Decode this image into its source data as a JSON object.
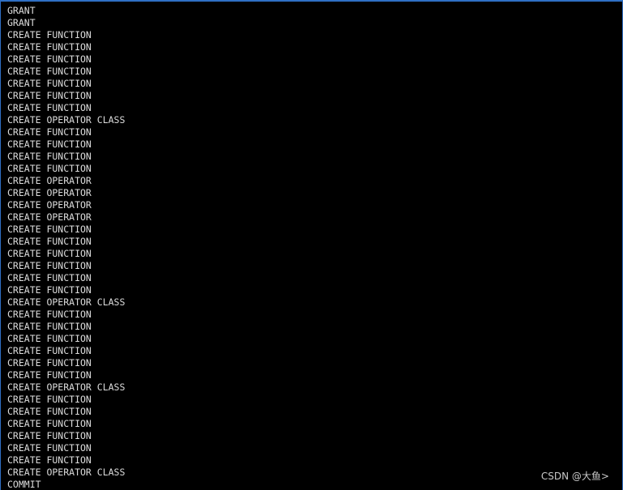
{
  "terminal": {
    "output_lines": [
      "GRANT",
      "GRANT",
      "CREATE FUNCTION",
      "CREATE FUNCTION",
      "CREATE FUNCTION",
      "CREATE FUNCTION",
      "CREATE FUNCTION",
      "CREATE FUNCTION",
      "CREATE FUNCTION",
      "CREATE OPERATOR CLASS",
      "CREATE FUNCTION",
      "CREATE FUNCTION",
      "CREATE FUNCTION",
      "CREATE FUNCTION",
      "CREATE OPERATOR",
      "CREATE OPERATOR",
      "CREATE OPERATOR",
      "CREATE OPERATOR",
      "CREATE FUNCTION",
      "CREATE FUNCTION",
      "CREATE FUNCTION",
      "CREATE FUNCTION",
      "CREATE FUNCTION",
      "CREATE FUNCTION",
      "CREATE OPERATOR CLASS",
      "CREATE FUNCTION",
      "CREATE FUNCTION",
      "CREATE FUNCTION",
      "CREATE FUNCTION",
      "CREATE FUNCTION",
      "CREATE FUNCTION",
      "CREATE OPERATOR CLASS",
      "CREATE FUNCTION",
      "CREATE FUNCTION",
      "CREATE FUNCTION",
      "CREATE FUNCTION",
      "CREATE FUNCTION",
      "CREATE FUNCTION",
      "CREATE OPERATOR CLASS",
      "COMMIT"
    ],
    "watermark": "CSDN @大鱼>"
  },
  "colors": {
    "background": "#000000",
    "text": "#dcdcdc",
    "window_border": "#2f6fc4"
  }
}
